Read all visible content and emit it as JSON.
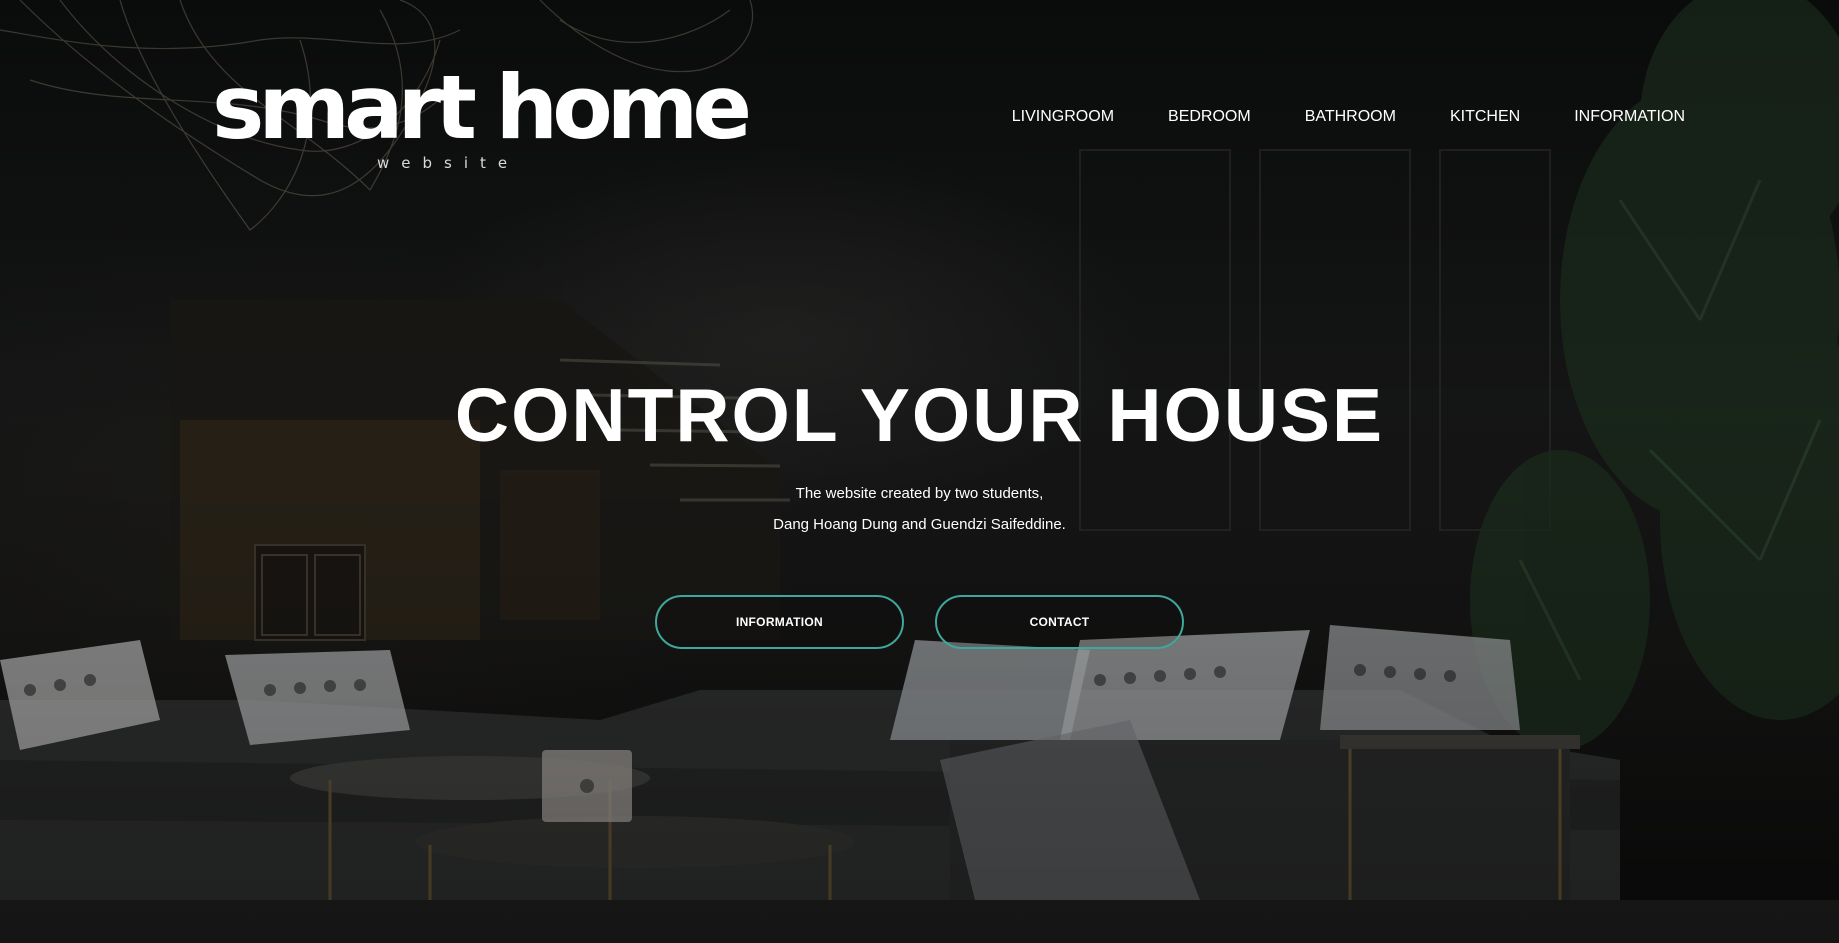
{
  "logo": {
    "main": "smart home",
    "sub": "website"
  },
  "nav": {
    "items": [
      {
        "label": "LIVINGROOM"
      },
      {
        "label": "BEDROOM"
      },
      {
        "label": "BATHROOM"
      },
      {
        "label": "KITCHEN"
      },
      {
        "label": "INFORMATION"
      }
    ]
  },
  "hero": {
    "title": "CONTROL YOUR HOUSE",
    "subtitle_line1": "The website created by two students,",
    "subtitle_line2": "Dang Hoang Dung and Guendzi Saifeddine.",
    "buttons": [
      {
        "label": "INFORMATION"
      },
      {
        "label": "CONTACT"
      }
    ]
  },
  "colors": {
    "accent": "#3fa79b",
    "background": "#0d0e0e",
    "text": "#ffffff"
  }
}
